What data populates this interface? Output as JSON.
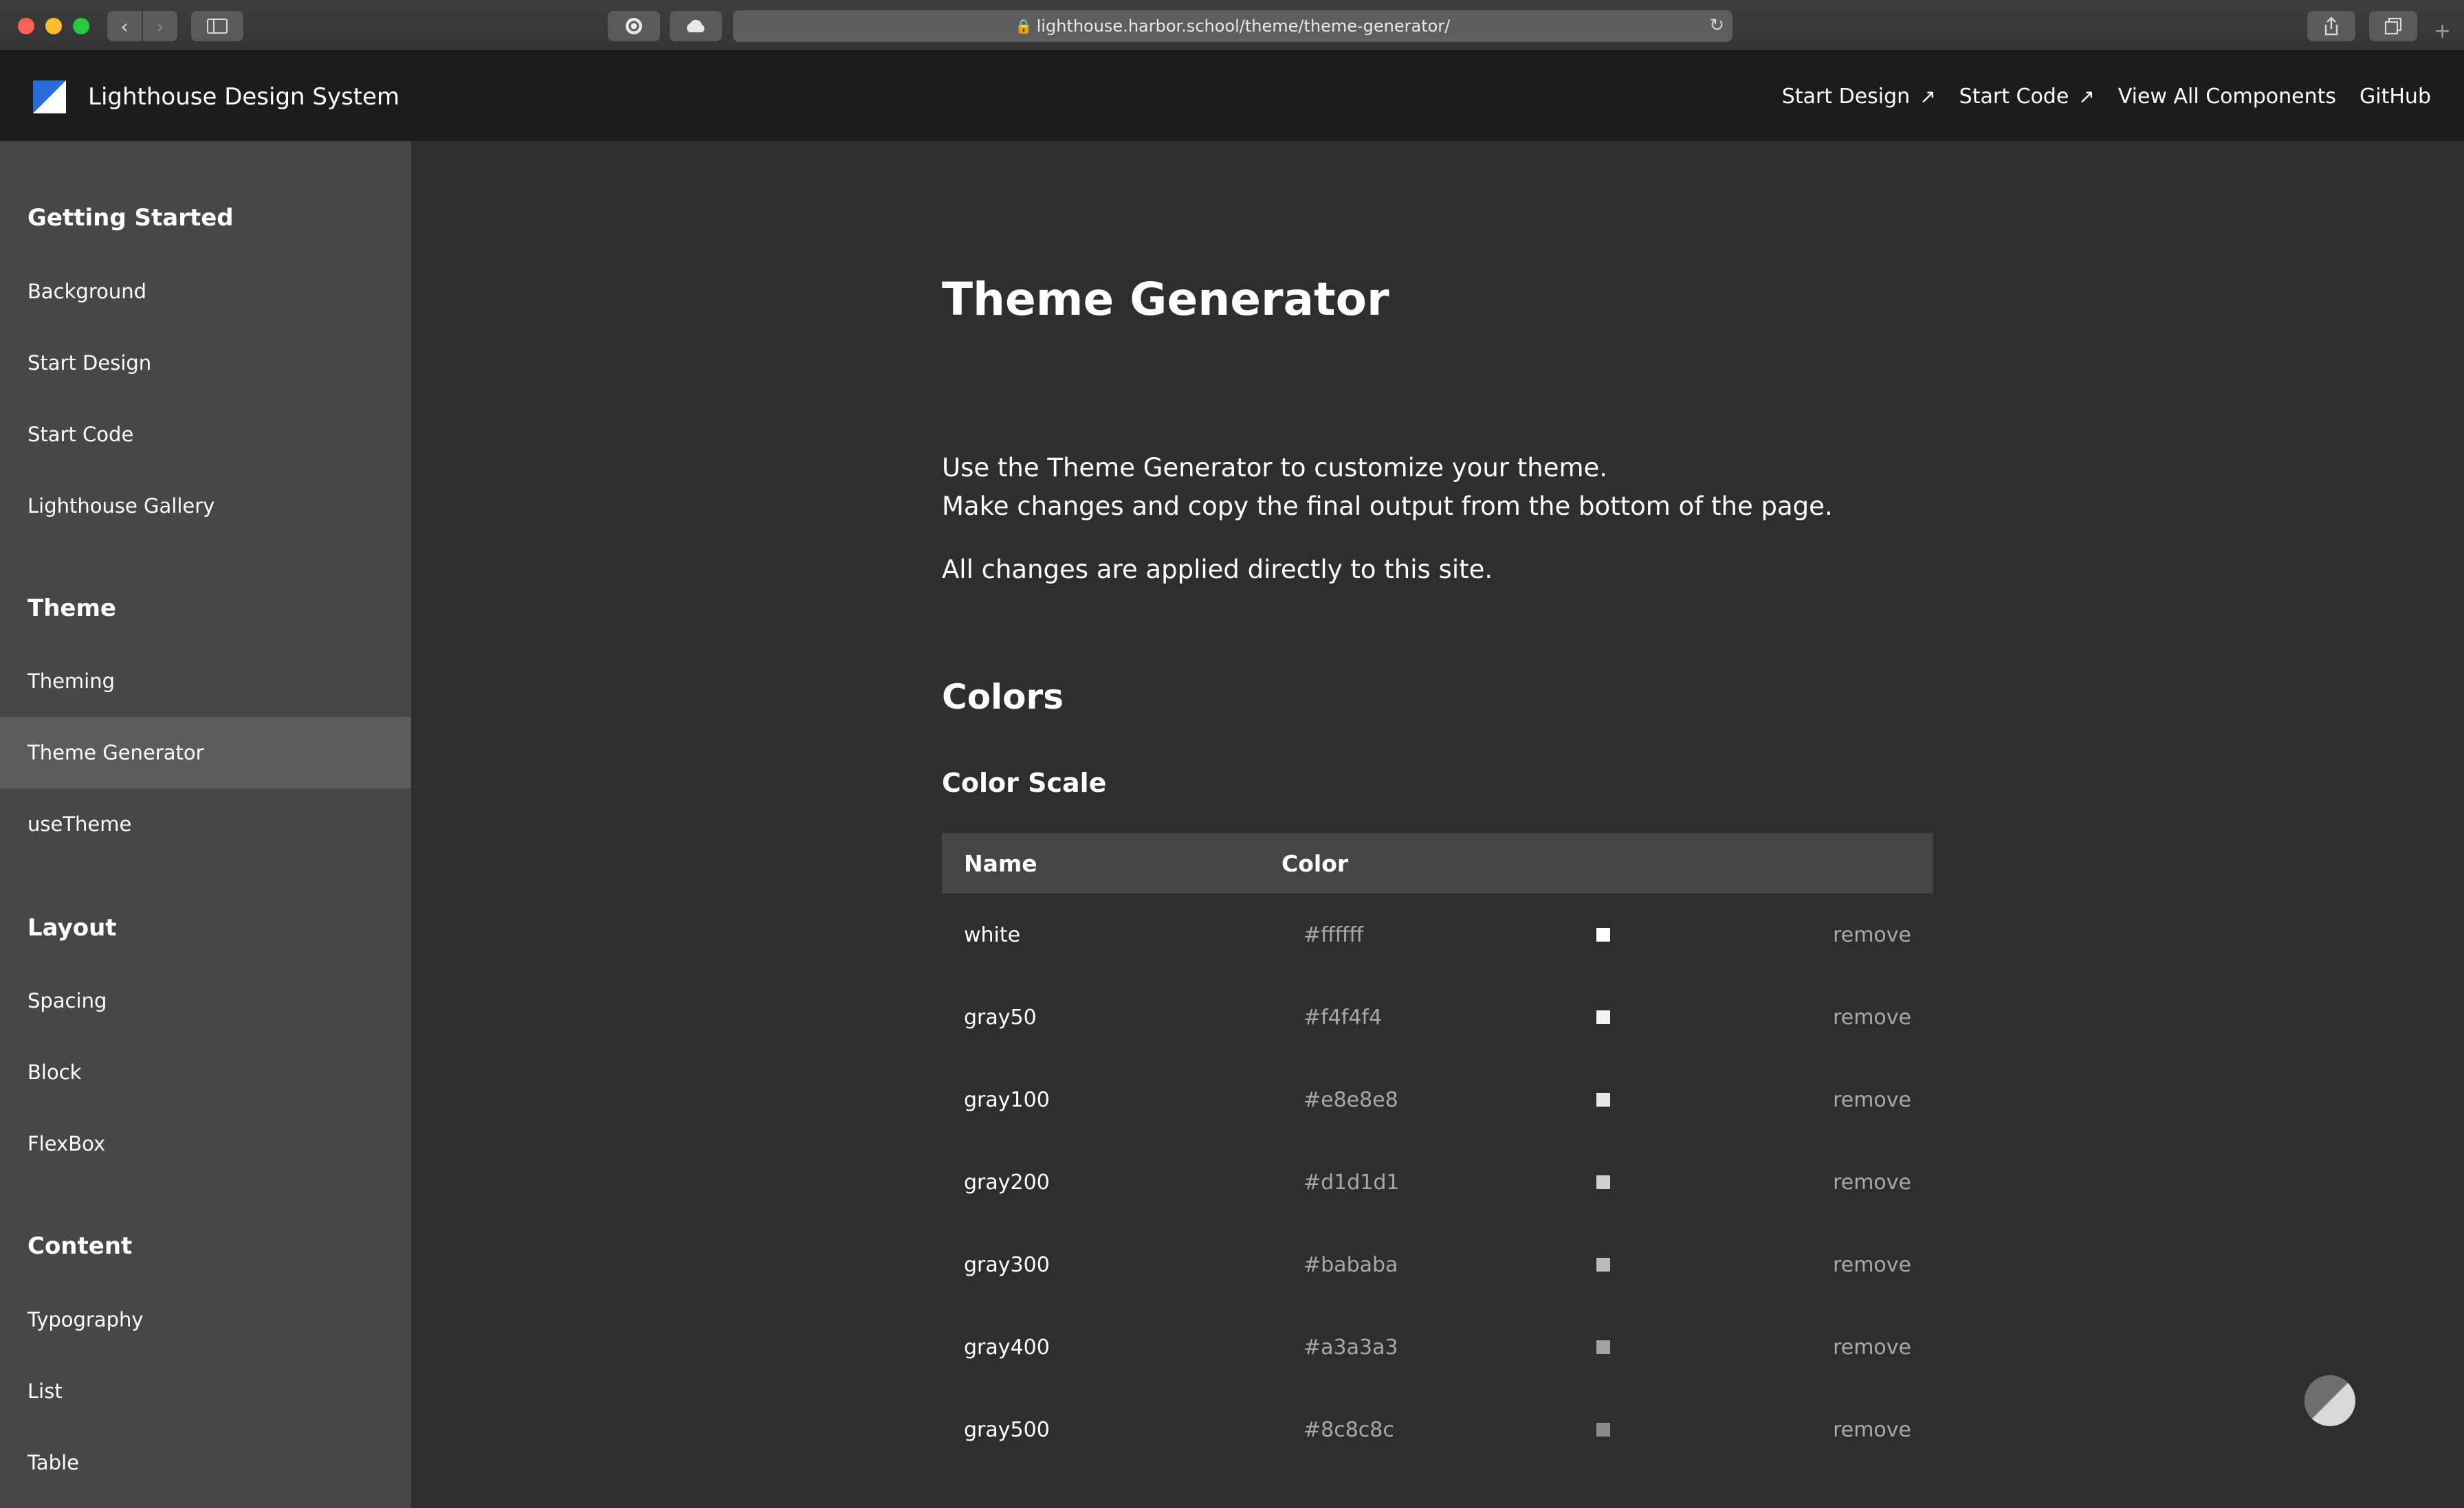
{
  "browser": {
    "url": "lighthouse.harbor.school/theme/theme-generator/"
  },
  "header": {
    "brand": "Lighthouse Design System",
    "nav": [
      {
        "label": "Start Design",
        "external": true
      },
      {
        "label": "Start Code",
        "external": true
      },
      {
        "label": "View All Components",
        "external": false
      },
      {
        "label": "GitHub",
        "external": false
      }
    ]
  },
  "sidebar": {
    "sections": [
      {
        "heading": "Getting Started",
        "items": [
          "Background",
          "Start Design",
          "Start Code",
          "Lighthouse Gallery"
        ]
      },
      {
        "heading": "Theme",
        "items": [
          "Theming",
          "Theme Generator",
          "useTheme"
        ]
      },
      {
        "heading": "Layout",
        "items": [
          "Spacing",
          "Block",
          "FlexBox"
        ]
      },
      {
        "heading": "Content",
        "items": [
          "Typography",
          "List",
          "Table"
        ]
      }
    ],
    "active_item": "Theme Generator"
  },
  "main": {
    "title": "Theme Generator",
    "intro_line1": "Use the Theme Generator to customize your theme.",
    "intro_line2": "Make changes and copy the final output from the bottom of the page.",
    "intro_line3": "All changes are applied directly to this site.",
    "section_title": "Colors",
    "subsection_title": "Color Scale",
    "table": {
      "headers": [
        "Name",
        "Color"
      ],
      "remove_label": "remove",
      "rows": [
        {
          "name": "white",
          "hex": "#ffffff"
        },
        {
          "name": "gray50",
          "hex": "#f4f4f4"
        },
        {
          "name": "gray100",
          "hex": "#e8e8e8"
        },
        {
          "name": "gray200",
          "hex": "#d1d1d1"
        },
        {
          "name": "gray300",
          "hex": "#bababa"
        },
        {
          "name": "gray400",
          "hex": "#a3a3a3"
        },
        {
          "name": "gray500",
          "hex": "#8c8c8c"
        }
      ]
    }
  },
  "colors": {
    "header_bg": "#1c1c1c",
    "sidebar_bg": "#474747",
    "sidebar_active_bg": "#5c5c5c",
    "content_bg": "#2e2e2e",
    "table_header_bg": "#454545",
    "logo_blue": "#2a6dd9"
  }
}
